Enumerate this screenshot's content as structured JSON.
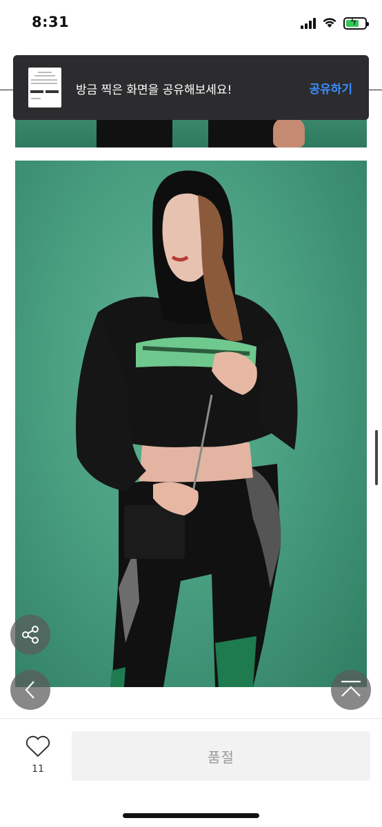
{
  "status_bar": {
    "time": "8:31",
    "icons": [
      "signal-icon",
      "wifi-icon",
      "battery-charging-icon"
    ],
    "battery_color": "#34c759"
  },
  "toast": {
    "message": "방금 찍은 화면을 공유해보세요!",
    "action_label": "공유하기",
    "action_color": "#3b8cff"
  },
  "floating_buttons": {
    "share_icon": "share-icon",
    "back_icon": "chevron-left-icon",
    "top_icon": "scroll-to-top-icon"
  },
  "bottom_bar": {
    "like_count": "11",
    "soldout_label": "품절"
  },
  "colors": {
    "backdrop_green": "#4a9f81",
    "toast_bg": "#2c2c2e",
    "button_disabled_bg": "#f2f2f2"
  }
}
